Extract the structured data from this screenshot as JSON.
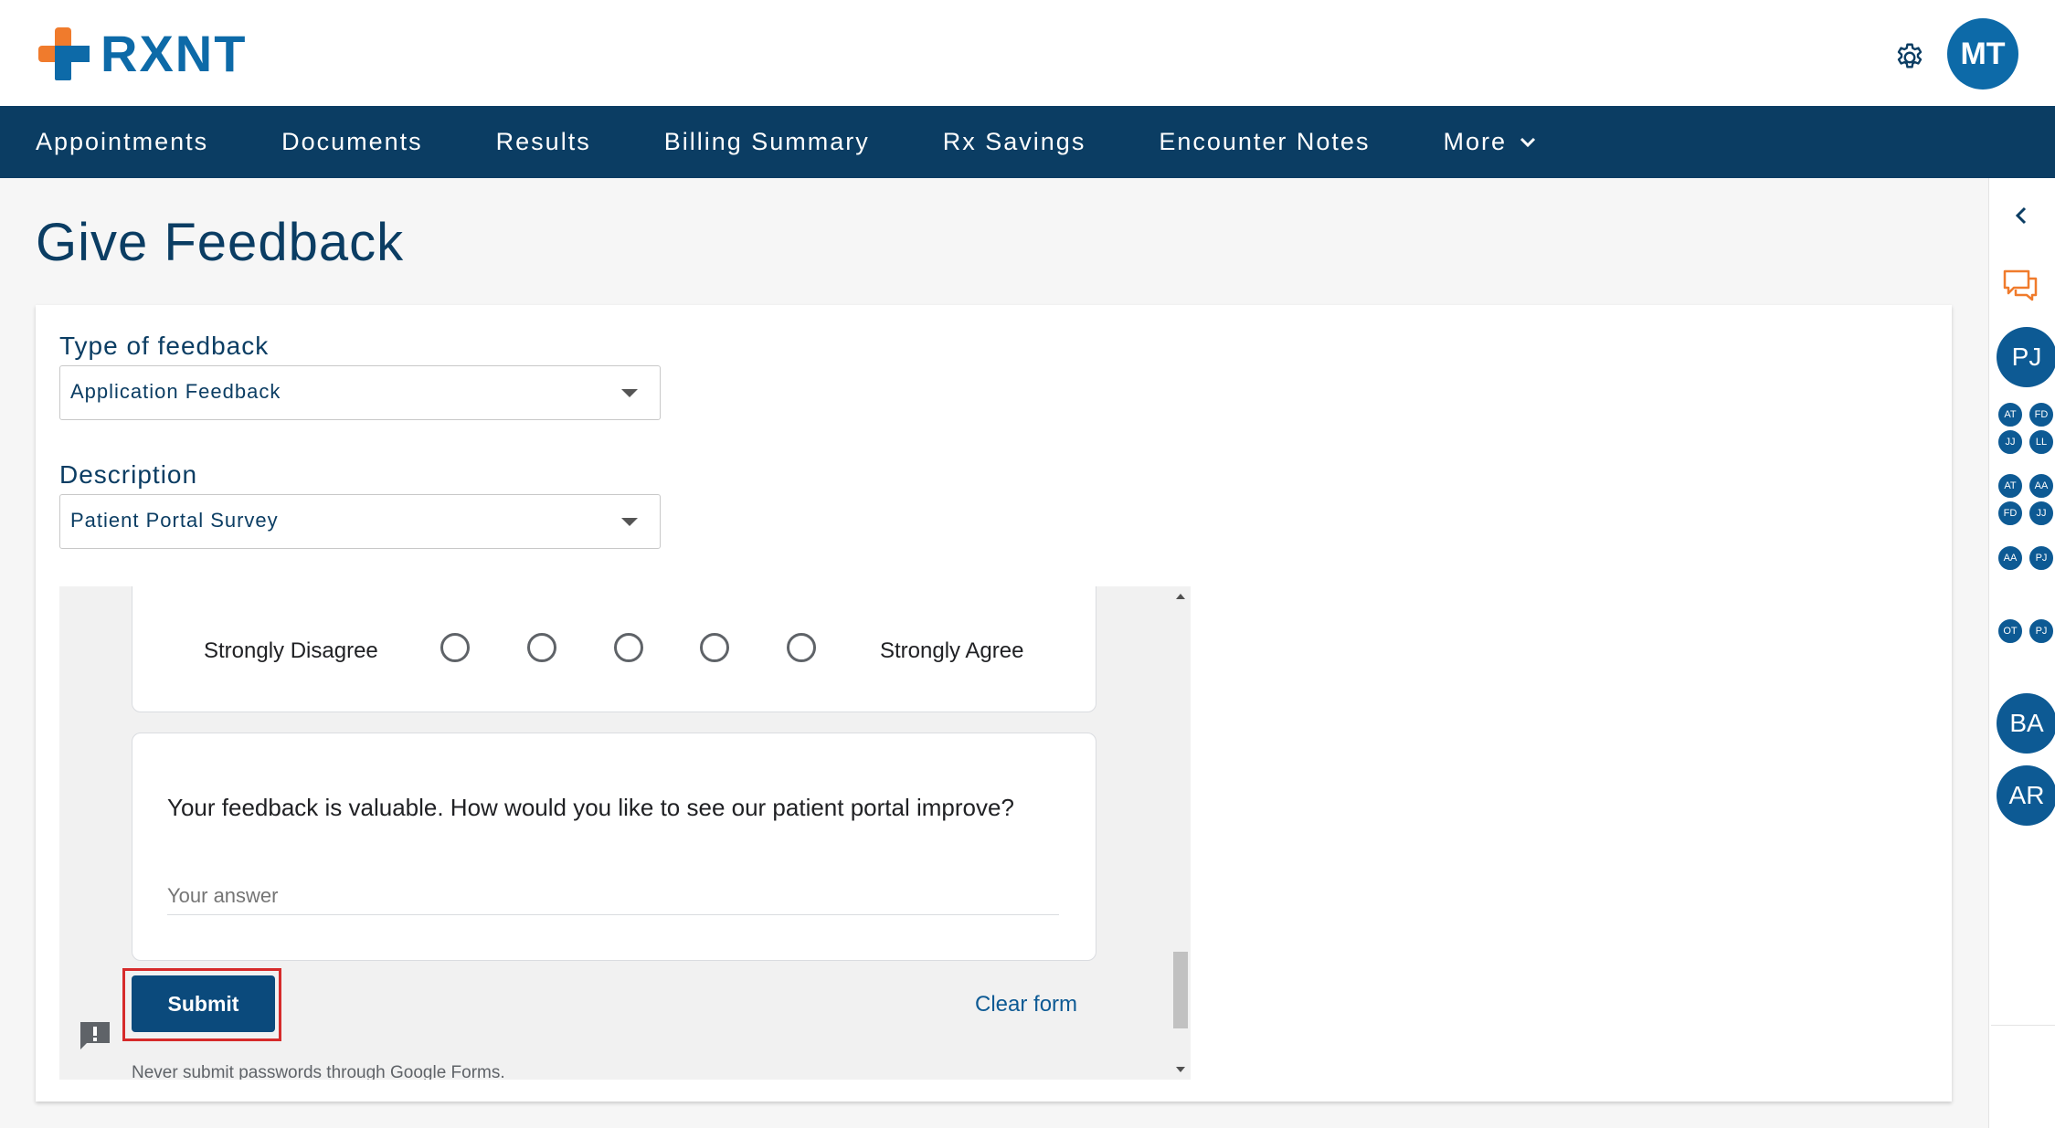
{
  "brand": {
    "name": "RXNT",
    "colors": {
      "primary_blue": "#0d6aa8",
      "nav_bg": "#0b3d63",
      "accent_orange": "#f07b2c",
      "highlight_red": "#d62b2b"
    }
  },
  "header": {
    "settings_icon": "gear-icon",
    "user_initials": "MT"
  },
  "nav": {
    "items": [
      "Appointments",
      "Documents",
      "Results",
      "Billing Summary",
      "Rx Savings",
      "Encounter Notes"
    ],
    "more_label": "More"
  },
  "page": {
    "title": "Give Feedback"
  },
  "form": {
    "type_label": "Type of feedback",
    "type_value": "Application Feedback",
    "description_label": "Description",
    "description_value": "Patient Portal Survey"
  },
  "survey": {
    "scale_low_label": "Strongly Disagree",
    "scale_high_label": "Strongly Agree",
    "scale_options_count": 5,
    "question": "Your feedback is valuable. How would you like to see our patient portal improve?",
    "answer_placeholder": "Your answer",
    "submit_label": "Submit",
    "clear_label": "Clear form",
    "disclaimer": "Never submit passwords through Google Forms."
  },
  "rail": {
    "collapse_icon": "chevron-left-icon",
    "chat_icon": "chat-icon",
    "avatar_pj": "PJ",
    "group1": [
      "AT",
      "FD",
      "JJ",
      "LL"
    ],
    "group2": [
      "AT",
      "AA",
      "FD",
      "JJ"
    ],
    "group3": [
      "AA",
      "PJ"
    ],
    "group4": [
      "OT",
      "PJ"
    ],
    "avatar_ba": "BA",
    "avatar_ar": "AR"
  }
}
